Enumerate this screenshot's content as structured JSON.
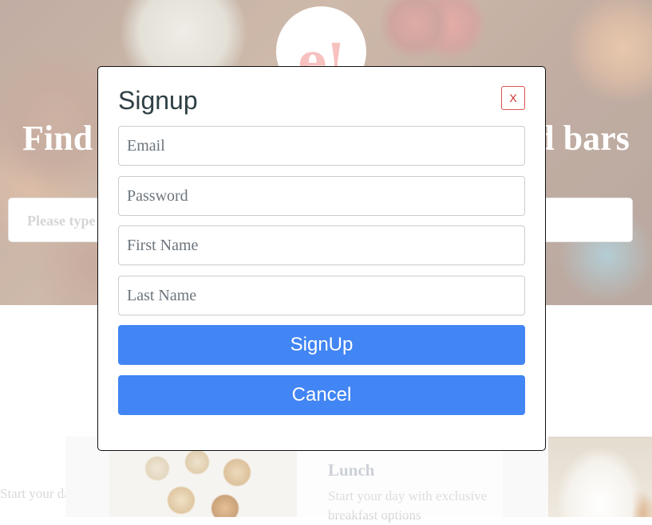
{
  "hero": {
    "logo_text": "e!",
    "heading": "Find the best restaurants, cafés and bars",
    "search_placeholder": "Please type a location"
  },
  "cards": {
    "left_partial_text": "Start your day with exclusive",
    "title": "Lunch",
    "description": "Start your day with exclusive breakfast options"
  },
  "modal": {
    "title": "Signup",
    "close_label": "X",
    "fields": {
      "email_placeholder": "Email",
      "password_placeholder": "Password",
      "first_name_placeholder": "First Name",
      "last_name_placeholder": "Last Name"
    },
    "signup_label": "SignUp",
    "cancel_label": "Cancel"
  },
  "colors": {
    "primary_button": "#4285f4",
    "close_border": "#d9534f",
    "logo": "#f2a7a4"
  }
}
